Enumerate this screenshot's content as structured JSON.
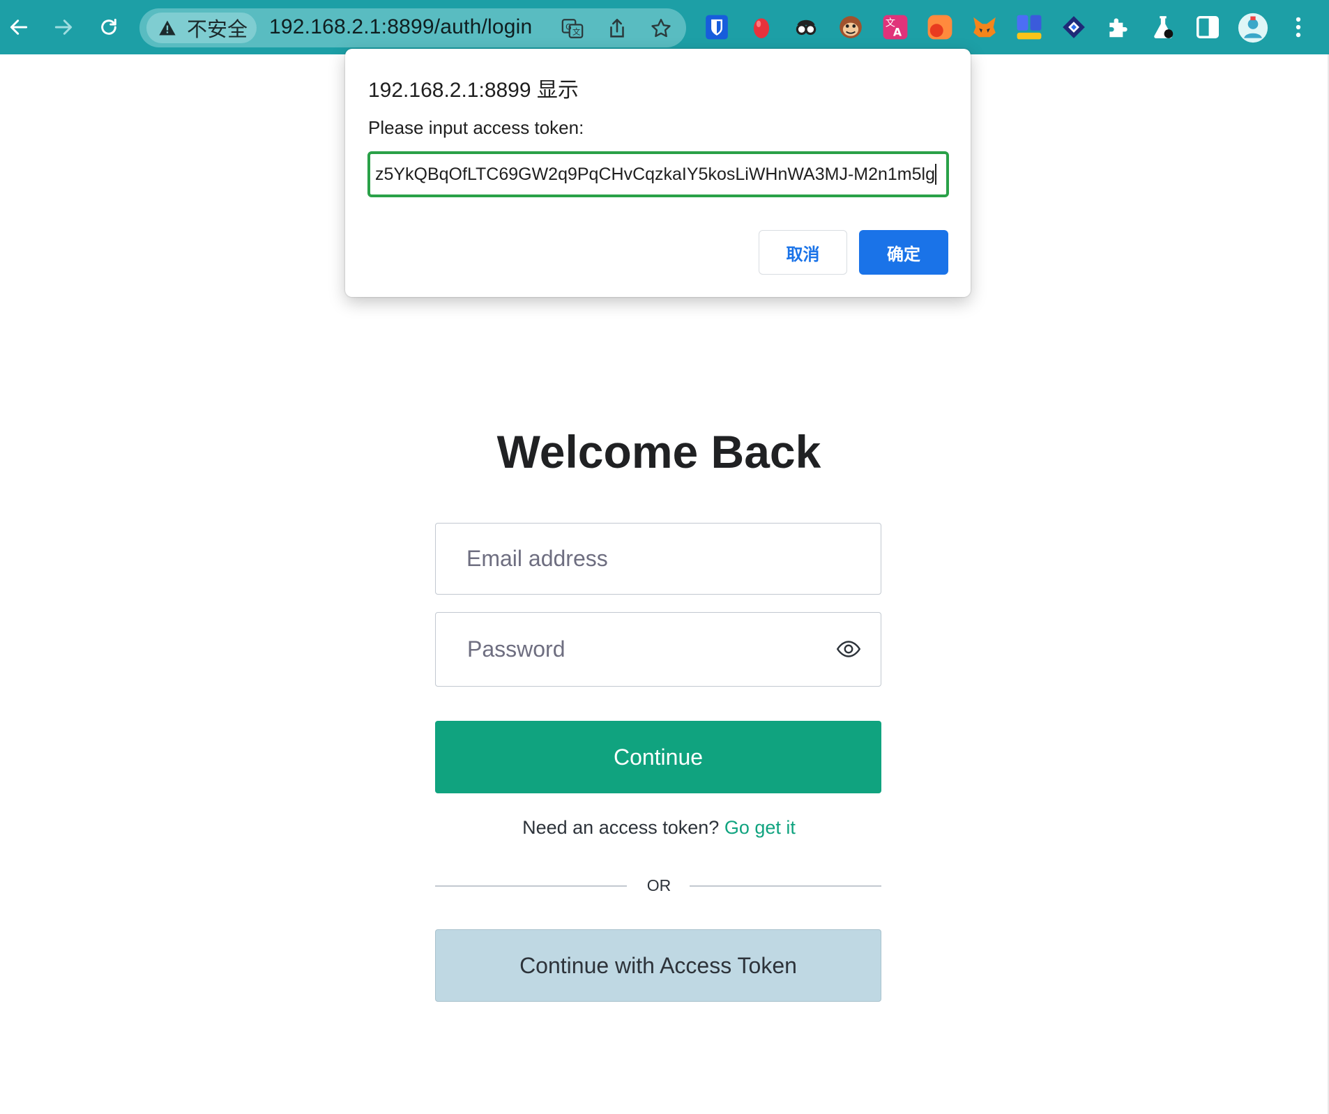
{
  "browser": {
    "security_label": "不安全",
    "url": "192.168.2.1:8899/auth/login",
    "toolbar_color": "#1d9fa6",
    "extensions": [
      "bitwarden-icon",
      "red-egg-icon",
      "spy-glasses-icon",
      "monkey-icon",
      "translate-icon",
      "orange-app-icon",
      "metamask-fox-icon",
      "blue-tile-icon",
      "diamond-icon",
      "puzzle-extensions-icon",
      "labs-flask-icon",
      "side-panel-icon",
      "profile-avatar",
      "more-menu-icon"
    ]
  },
  "dialog": {
    "title": "192.168.2.1:8899 显示",
    "message": "Please input access token:",
    "input_value": "z5YkQBqOfLTC69GW2q9PqCHvCqzkaIY5kosLiWHnWA3MJ-M2n1m5lg",
    "cancel_label": "取消",
    "ok_label": "确定"
  },
  "login": {
    "heading": "Welcome Back",
    "email_placeholder": "Email address",
    "password_placeholder": "Password",
    "continue_label": "Continue",
    "need_token_text": "Need an access token?",
    "get_it_link": "Go get it",
    "or_label": "OR",
    "token_button_label": "Continue with Access Token",
    "accent_color": "#10a37f"
  }
}
